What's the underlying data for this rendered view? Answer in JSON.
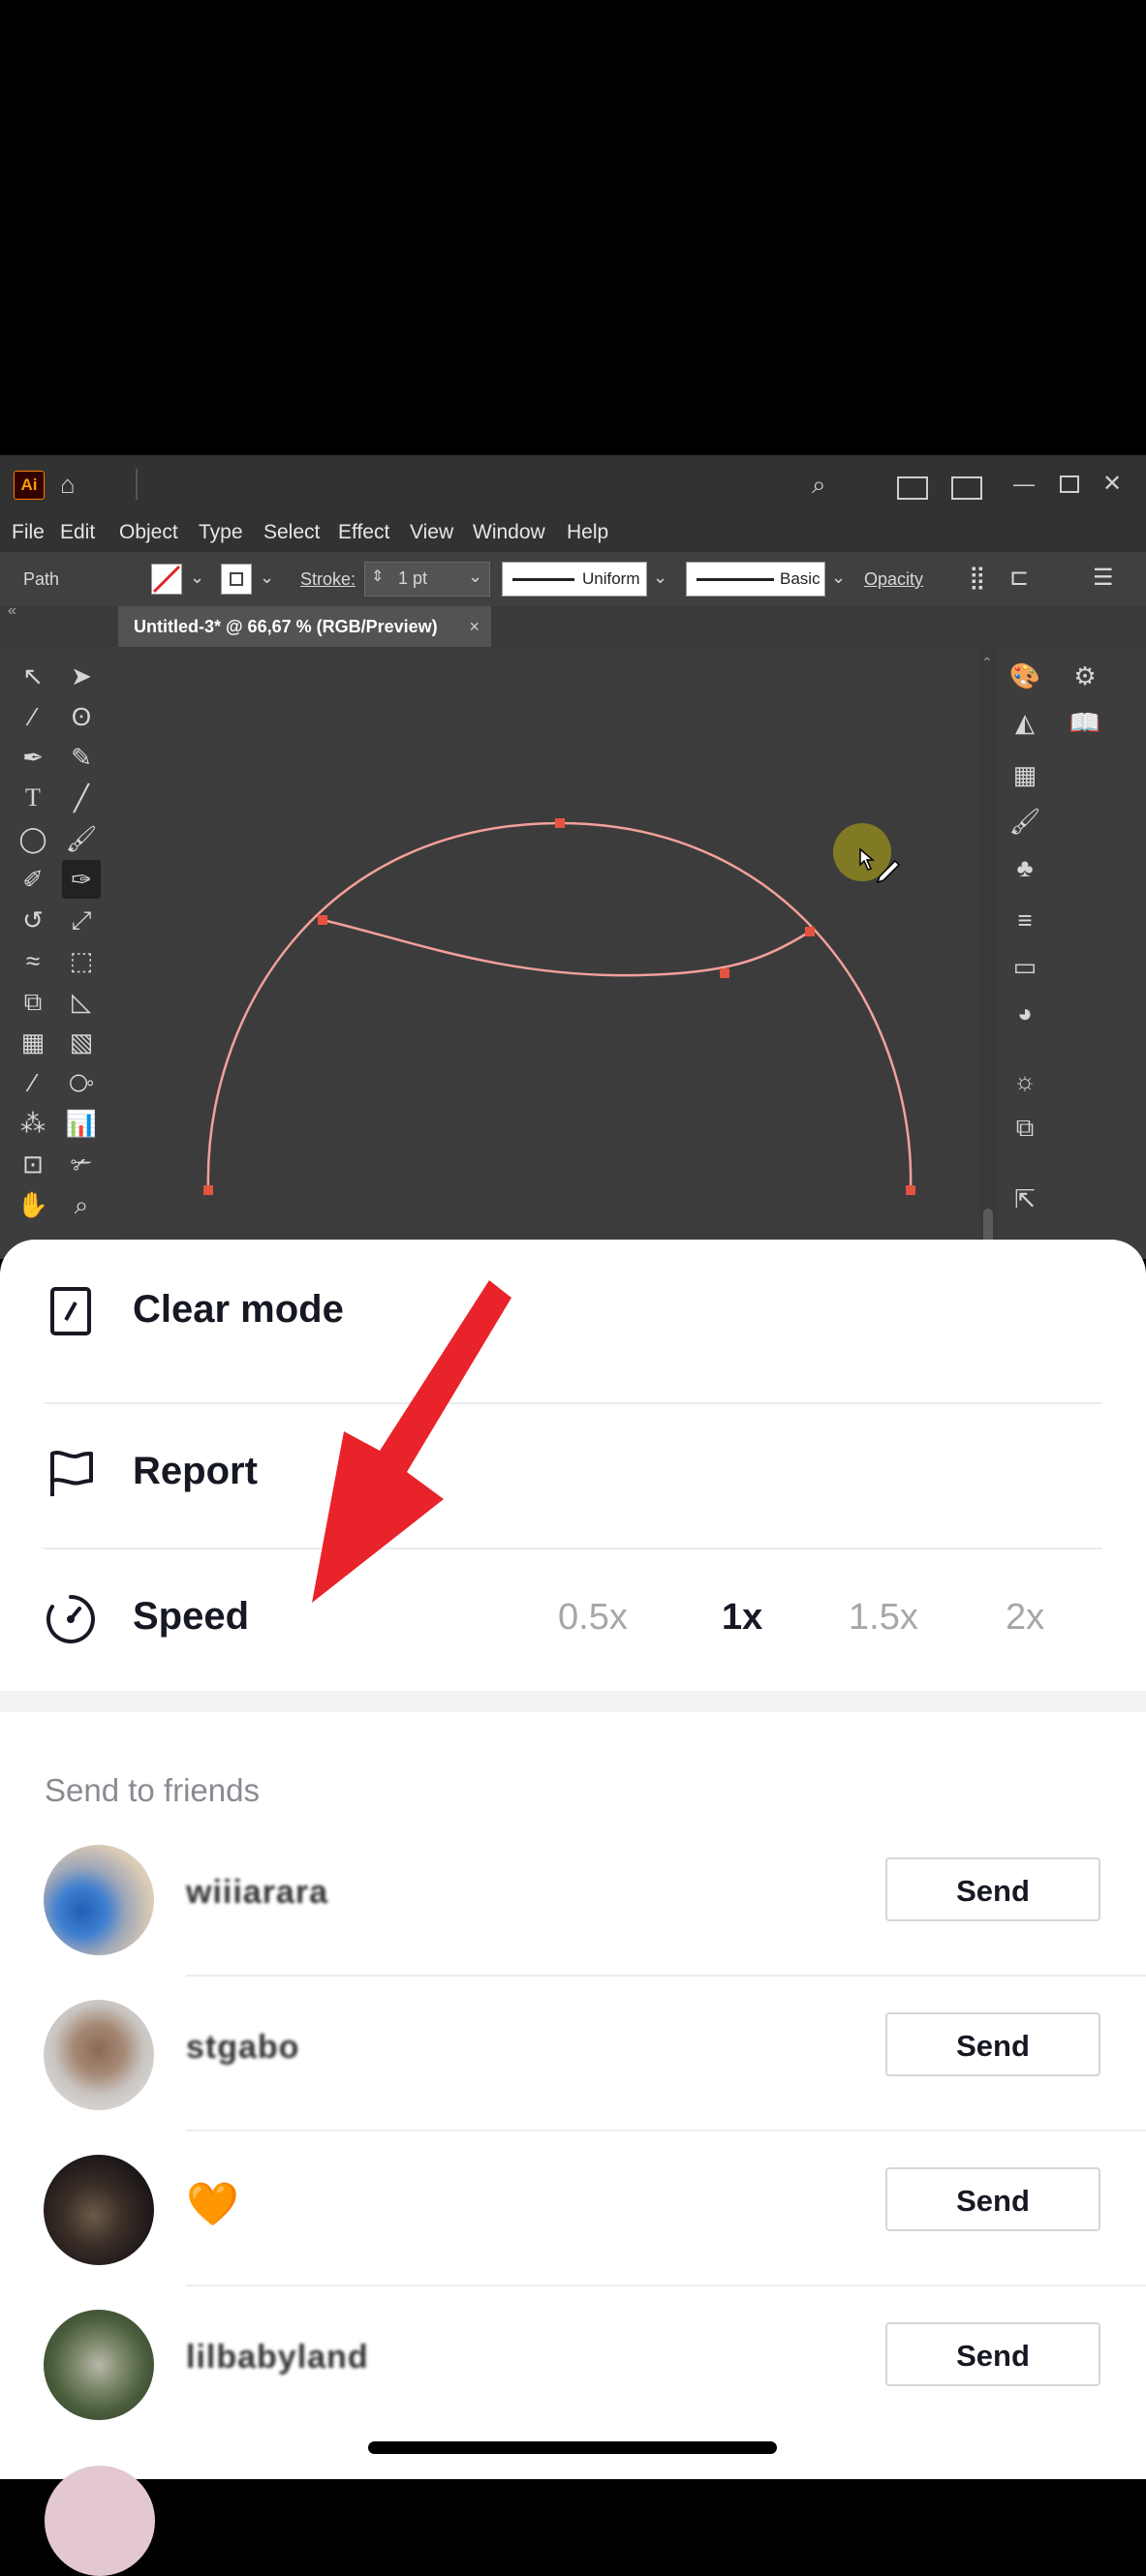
{
  "illustrator": {
    "app_logo": "Ai",
    "menu": [
      "File",
      "Edit",
      "Object",
      "Type",
      "Select",
      "Effect",
      "View",
      "Window",
      "Help"
    ],
    "control_bar": {
      "selection_label": "Path",
      "stroke_label": "Stroke:",
      "stroke_value": "1 pt",
      "profile_label": "Uniform",
      "brush_label": "Basic",
      "opacity_label": "Opacity"
    },
    "document_tab": "Untitled-3* @ 66,67 % (RGB/Preview)",
    "tab_close": "×",
    "path_color": "#f3a09a",
    "anchor_color": "#e5533f"
  },
  "sheet": {
    "clear_mode_label": "Clear mode",
    "report_label": "Report",
    "speed_label": "Speed",
    "speed_options": [
      "0.5x",
      "1x",
      "1.5x",
      "2x"
    ],
    "speed_selected": "1x",
    "send_to_friends_title": "Send to friends",
    "friends": [
      {
        "name": "wiiiarara",
        "send_label": "Send"
      },
      {
        "name": "stgabo",
        "send_label": "Send"
      },
      {
        "name": "🧡",
        "send_label": "Send"
      },
      {
        "name": "lilbabyland",
        "send_label": "Send"
      }
    ]
  },
  "annotation": {
    "arrow_color": "#e8232a"
  }
}
